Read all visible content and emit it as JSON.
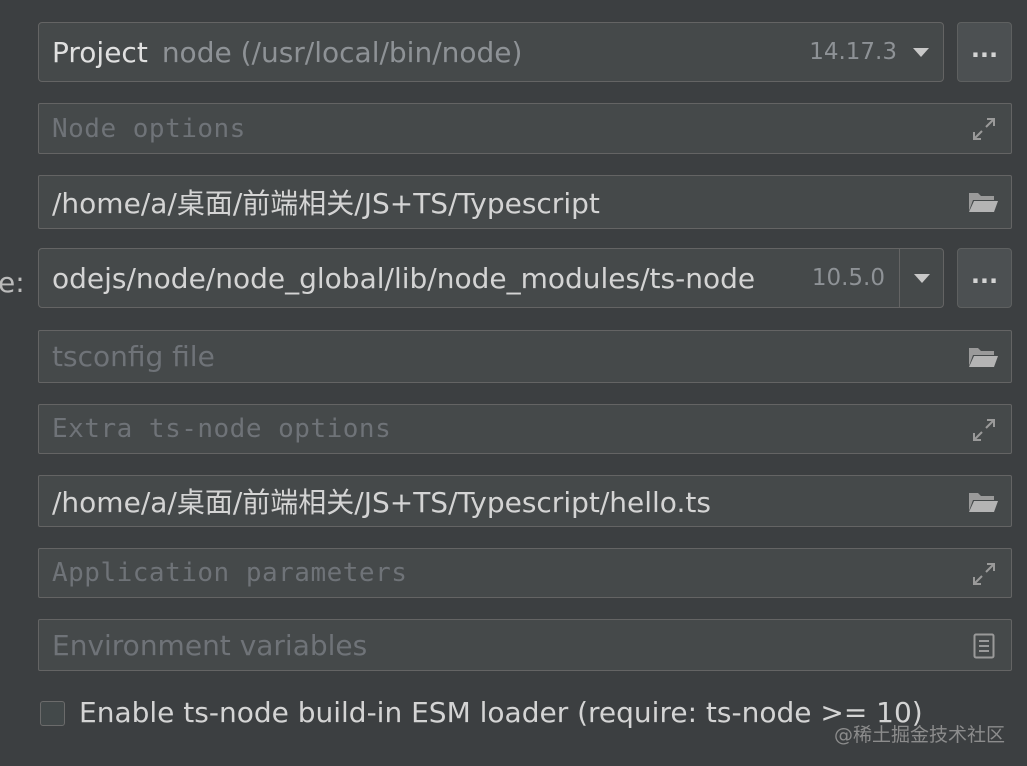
{
  "interpreter": {
    "label": "Project",
    "path": "node (/usr/local/bin/node)",
    "version": "14.17.3",
    "browse_label": "..."
  },
  "node_options": {
    "placeholder": "Node options"
  },
  "working_dir": {
    "value": "/home/a/桌面/前端相关/JS+TS/Typescript"
  },
  "ts_node": {
    "label_fragment": "e:",
    "path": "odejs/node/node_global/lib/node_modules/ts-node",
    "version": "10.5.0",
    "browse_label": "..."
  },
  "tsconfig": {
    "placeholder": "tsconfig file"
  },
  "extra_options": {
    "placeholder": "Extra ts-node options"
  },
  "script_file": {
    "value": "/home/a/桌面/前端相关/JS+TS/Typescript/hello.ts"
  },
  "app_params": {
    "placeholder": "Application parameters"
  },
  "env_vars": {
    "placeholder": "Environment variables"
  },
  "esm_loader": {
    "label": "Enable ts-node build-in ESM loader (require: ts-node >= 10)",
    "checked": false
  },
  "watermark": "@稀土掘金技术社区",
  "icons": {
    "expand": "expand-icon",
    "folder": "folder-icon",
    "list": "list-edit-icon",
    "dropdown": "chevron-down-icon"
  }
}
